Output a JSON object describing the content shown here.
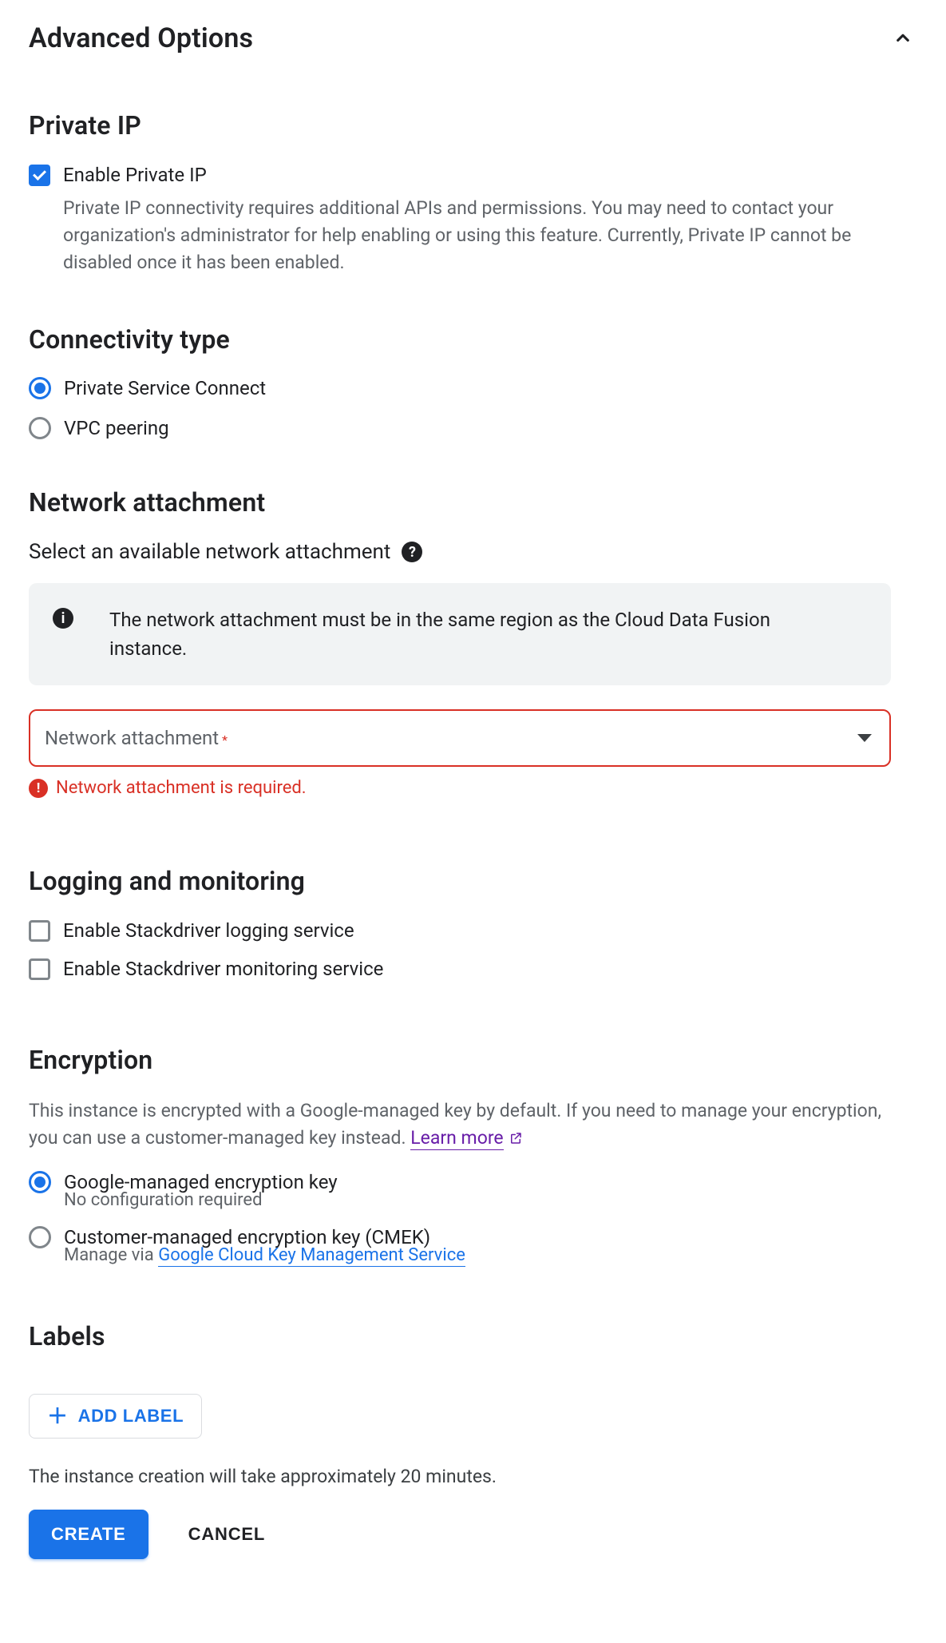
{
  "header": {
    "title": "Advanced Options"
  },
  "private_ip": {
    "title": "Private IP",
    "enable_label": "Enable Private IP",
    "enable_checked": true,
    "description": "Private IP connectivity requires additional APIs and permissions. You may need to contact your organization's administrator for help enabling or using this feature. Currently, Private IP cannot be disabled once it has been enabled."
  },
  "connectivity": {
    "title": "Connectivity type",
    "options": [
      {
        "label": "Private Service Connect",
        "selected": true
      },
      {
        "label": "VPC peering",
        "selected": false
      }
    ]
  },
  "network_attachment": {
    "title": "Network attachment",
    "caption": "Select an available network attachment",
    "info": "The network attachment must be in the same region as the Cloud Data Fusion instance.",
    "select_placeholder": "Network attachment",
    "select_required_marker": "*",
    "error": "Network attachment is required."
  },
  "logging": {
    "title": "Logging and monitoring",
    "options": [
      {
        "label": "Enable Stackdriver logging service",
        "checked": false
      },
      {
        "label": "Enable Stackdriver monitoring service",
        "checked": false
      }
    ]
  },
  "encryption": {
    "title": "Encryption",
    "description": "This instance is encrypted with a Google-managed key by default. If you need to manage your encryption, you can use a customer-managed key instead. ",
    "learn_more": "Learn more",
    "options": [
      {
        "label": "Google-managed encryption key",
        "sub": "No configuration required",
        "selected": true
      },
      {
        "label": "Customer-managed encryption key (CMEK)",
        "sub_prefix": "Manage via ",
        "sub_link": "Google Cloud Key Management Service",
        "selected": false
      }
    ]
  },
  "labels": {
    "title": "Labels",
    "add_button": "ADD LABEL"
  },
  "footer": {
    "note": "The instance creation will take approximately 20 minutes.",
    "create": "CREATE",
    "cancel": "CANCEL"
  }
}
